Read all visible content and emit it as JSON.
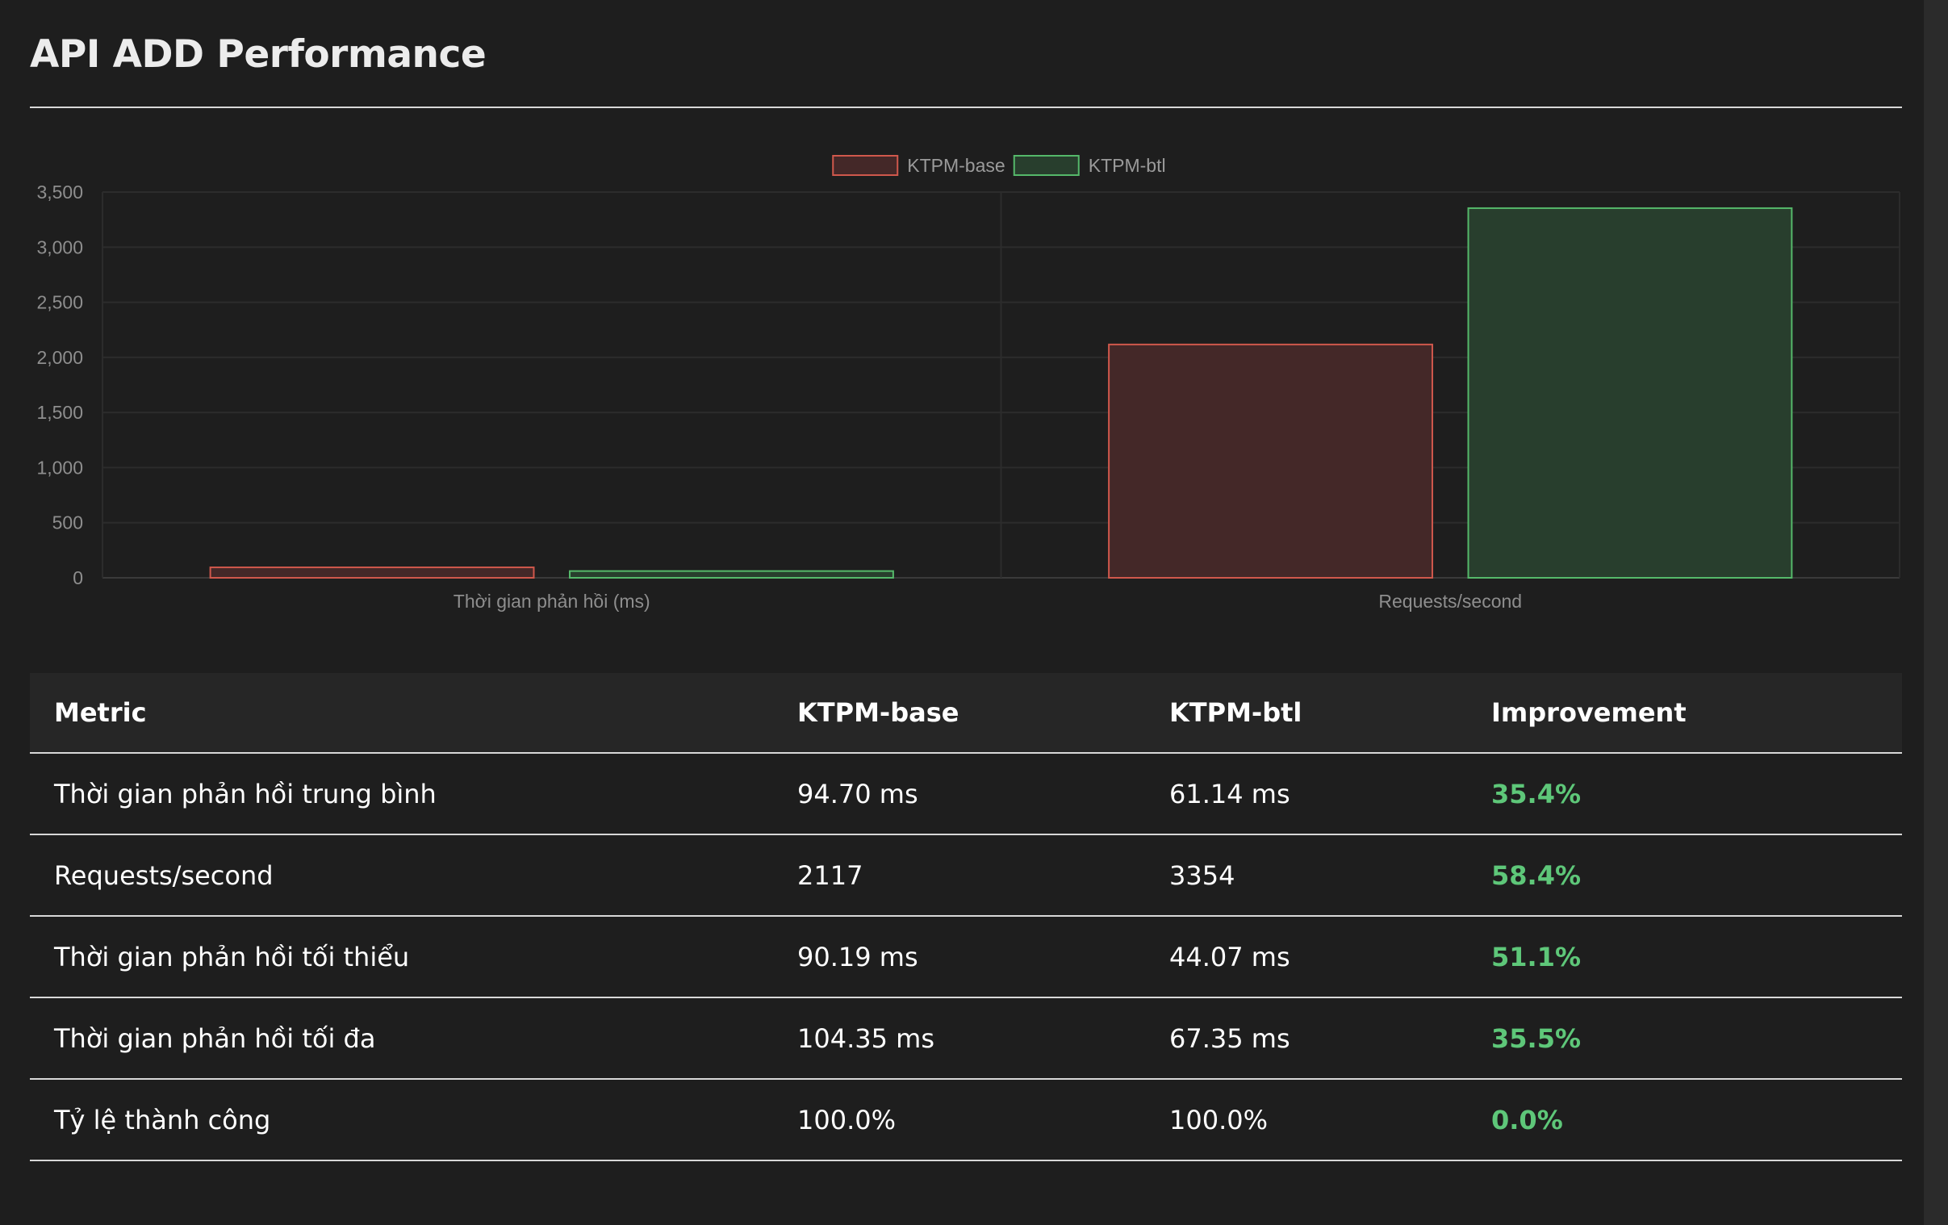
{
  "page": {
    "title": "API ADD Performance"
  },
  "chart_data": {
    "type": "bar",
    "categories": [
      "Thời gian phản hồi (ms)",
      "Requests/second"
    ],
    "series": [
      {
        "name": "KTPM-base",
        "values": [
          94.7,
          2117
        ],
        "border": "#d0584c",
        "fill": "#442828"
      },
      {
        "name": "KTPM-btl",
        "values": [
          61.14,
          3354
        ],
        "border": "#55b86a",
        "fill": "#283e2d"
      }
    ],
    "yticks": [
      0,
      500,
      1000,
      1500,
      2000,
      2500,
      3000,
      3500
    ],
    "ytick_labels": [
      "0",
      "500",
      "1,000",
      "1,500",
      "2,000",
      "2,500",
      "3,000",
      "3,500"
    ],
    "ylim": [
      0,
      3500
    ],
    "xlabel": "",
    "ylabel": "",
    "grid": true,
    "legend_position": "top-center"
  },
  "table": {
    "headers": [
      "Metric",
      "KTPM-base",
      "KTPM-btl",
      "Improvement"
    ],
    "rows": [
      [
        "Thời gian phản hồi trung bình",
        "94.70 ms",
        "61.14 ms",
        "35.4%"
      ],
      [
        "Requests/second",
        "2117",
        "3354",
        "58.4%"
      ],
      [
        "Thời gian phản hồi tối thiểu",
        "90.19 ms",
        "44.07 ms",
        "51.1%"
      ],
      [
        "Thời gian phản hồi tối đa",
        "104.35 ms",
        "67.35 ms",
        "35.5%"
      ],
      [
        "Tỷ lệ thành công",
        "100.0%",
        "100.0%",
        "0.0%"
      ]
    ]
  },
  "colors": {
    "background": "#1e1e1e",
    "improvement": "#5ec779"
  }
}
